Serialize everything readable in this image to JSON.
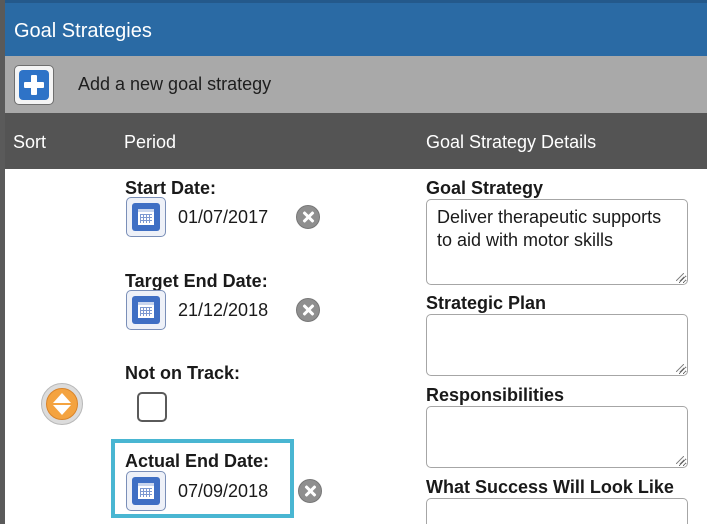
{
  "header": {
    "title": "Goal Strategies"
  },
  "add_bar": {
    "label": "Add a new goal strategy",
    "button_icon": "plus-icon"
  },
  "columns": {
    "sort": "Sort",
    "period": "Period",
    "details": "Goal Strategy Details"
  },
  "period": {
    "start_date": {
      "label": "Start Date:",
      "value": "01/07/2017"
    },
    "target_end_date": {
      "label": "Target End Date:",
      "value": "21/12/2018"
    },
    "not_on_track": {
      "label": "Not on Track:",
      "checked": false
    },
    "actual_end_date": {
      "label": "Actual End Date:",
      "value": "07/09/2018"
    }
  },
  "details": {
    "goal_strategy": {
      "label": "Goal Strategy",
      "value": "Deliver therapeutic supports to aid with motor skills"
    },
    "strategic_plan": {
      "label": "Strategic Plan",
      "value": ""
    },
    "responsibilities": {
      "label": "Responsibilities",
      "value": ""
    },
    "success": {
      "label": "What Success Will Look Like",
      "value": ""
    }
  },
  "colors": {
    "header_bg": "#2a6aa4",
    "add_bar_bg": "#a9a9a9",
    "column_header_bg": "#545454",
    "highlight_border": "#49b6d2",
    "sort_handle": "#f4a340",
    "add_button": "#2e73c7"
  }
}
